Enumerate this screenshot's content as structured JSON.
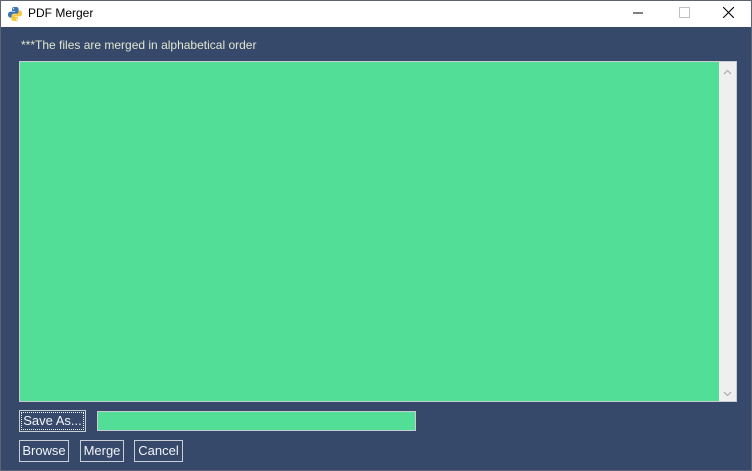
{
  "window": {
    "title": "PDF Merger",
    "controls": {
      "minimize_icon": "minimize-icon",
      "maximize_icon": "maximize-icon",
      "close_icon": "close-icon"
    }
  },
  "note": "***The files are merged in alphabetical order",
  "file_list": {
    "items": [],
    "background_color": "#53de98"
  },
  "save_row": {
    "save_as_label": "Save As...",
    "output_path_value": ""
  },
  "actions": {
    "browse_label": "Browse",
    "merge_label": "Merge",
    "cancel_label": "Cancel"
  },
  "colors": {
    "window_bg": "#37496a",
    "accent_green": "#53de98",
    "note_text": "#dfe6cf"
  }
}
